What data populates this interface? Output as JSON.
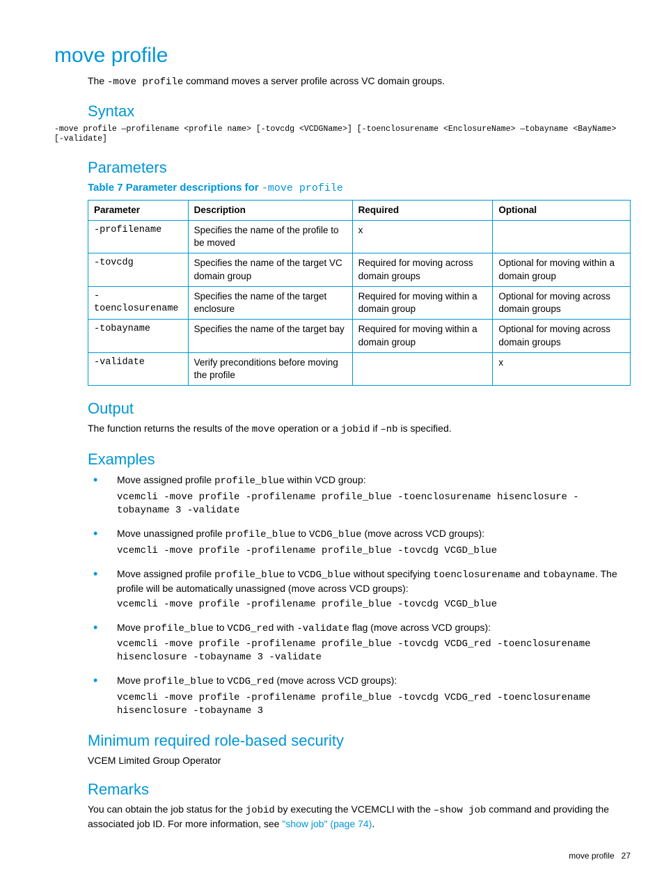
{
  "pageTitle": "move profile",
  "introPrefix": "The ",
  "introCmd": "-move profile",
  "introSuffix": " command moves a server profile across VC domain groups.",
  "syntax": {
    "heading": "Syntax",
    "text": "-move profile —profilename <profile name> [-tovcdg <VCDGName>] [-toenclosurename <EnclosureName> —tobayname <BayName> [-validate]"
  },
  "parameters": {
    "heading": "Parameters",
    "tableTitlePrefix": "Table 7 Parameter descriptions for ",
    "tableTitleCmd": "-move profile",
    "headers": {
      "c1": "Parameter",
      "c2": "Description",
      "c3": "Required",
      "c4": "Optional"
    },
    "rows": [
      {
        "p": "-profilename",
        "d": "Specifies the name of the profile to be moved",
        "r": "x",
        "o": ""
      },
      {
        "p": "-tovcdg",
        "d": "Specifies the name of the target VC domain group",
        "r": "Required for moving across domain groups",
        "o": "Optional for moving within a domain group"
      },
      {
        "p": "-toenclosurename",
        "d": "Specifies the name of the target enclosure",
        "r": "Required for moving within a domain group",
        "o": "Optional for moving across domain groups"
      },
      {
        "p": "-tobayname",
        "d": "Specifies the name of the target bay",
        "r": "Required for moving within a domain group",
        "o": "Optional for moving across domain groups"
      },
      {
        "p": "-validate",
        "d": "Verify preconditions before moving the profile",
        "r": "",
        "o": "x"
      }
    ]
  },
  "output": {
    "heading": "Output",
    "pre1": "The function returns the results of the ",
    "code1": "move",
    "mid1": " operation or a ",
    "code2": "jobid",
    "mid2": " if ",
    "code3": "–nb",
    "post": " is specified."
  },
  "examples": {
    "heading": "Examples",
    "items": [
      {
        "desc_parts": [
          "Move assigned profile ",
          {
            "mono": "profile_blue"
          },
          " within VCD group:"
        ],
        "cmd": "vcemcli -move profile -profilename profile_blue -toenclosurename hisenclosure -tobayname 3 -validate"
      },
      {
        "desc_parts": [
          "Move unassigned profile ",
          {
            "mono": "profile_blue"
          },
          " to ",
          {
            "mono": "VCDG_blue"
          },
          " (move across VCD groups):"
        ],
        "cmd": "vcemcli -move profile -profilename profile_blue -tovcdg VCGD_blue"
      },
      {
        "desc_parts": [
          "Move assigned profile ",
          {
            "mono": "profile_blue"
          },
          " to ",
          {
            "mono": "VCDG_blue"
          },
          " without specifying ",
          {
            "mono": "toenclosurename"
          },
          " and ",
          {
            "mono": "tobayname"
          },
          ". The profile will be automatically unassigned (move across VCD groups):"
        ],
        "cmd": "vcemcli -move profile -profilename profile_blue -tovcdg VCGD_blue"
      },
      {
        "desc_parts": [
          "Move ",
          {
            "mono": "profile_blue"
          },
          " to ",
          {
            "mono": "VCDG_red"
          },
          " with ",
          {
            "mono": "-validate"
          },
          " flag (move across VCD groups):"
        ],
        "cmd": "vcemcli -move profile -profilename profile_blue -tovcdg VCDG_red -toenclosurename hisenclosure -tobayname 3 -validate"
      },
      {
        "desc_parts": [
          "Move ",
          {
            "mono": "profile_blue"
          },
          " to ",
          {
            "mono": "VCDG_red"
          },
          " (move across VCD groups):"
        ],
        "cmd": "vcemcli -move profile -profilename profile_blue -tovcdg VCDG_red -toenclosurename hisenclosure -tobayname 3"
      }
    ]
  },
  "minrole": {
    "heading": "Minimum required role-based security",
    "text": "VCEM Limited Group Operator"
  },
  "remarks": {
    "heading": "Remarks",
    "pre1": "You can obtain the job status for the ",
    "code1": "jobid",
    "mid1": " by executing the VCEMCLI with the ",
    "code2": "–show job",
    "mid2": " command and providing the associated job ID. For more information, see ",
    "link": "\"show job\" (page 74)",
    "post": "."
  },
  "footer": {
    "label": "move profile",
    "page": "27"
  }
}
